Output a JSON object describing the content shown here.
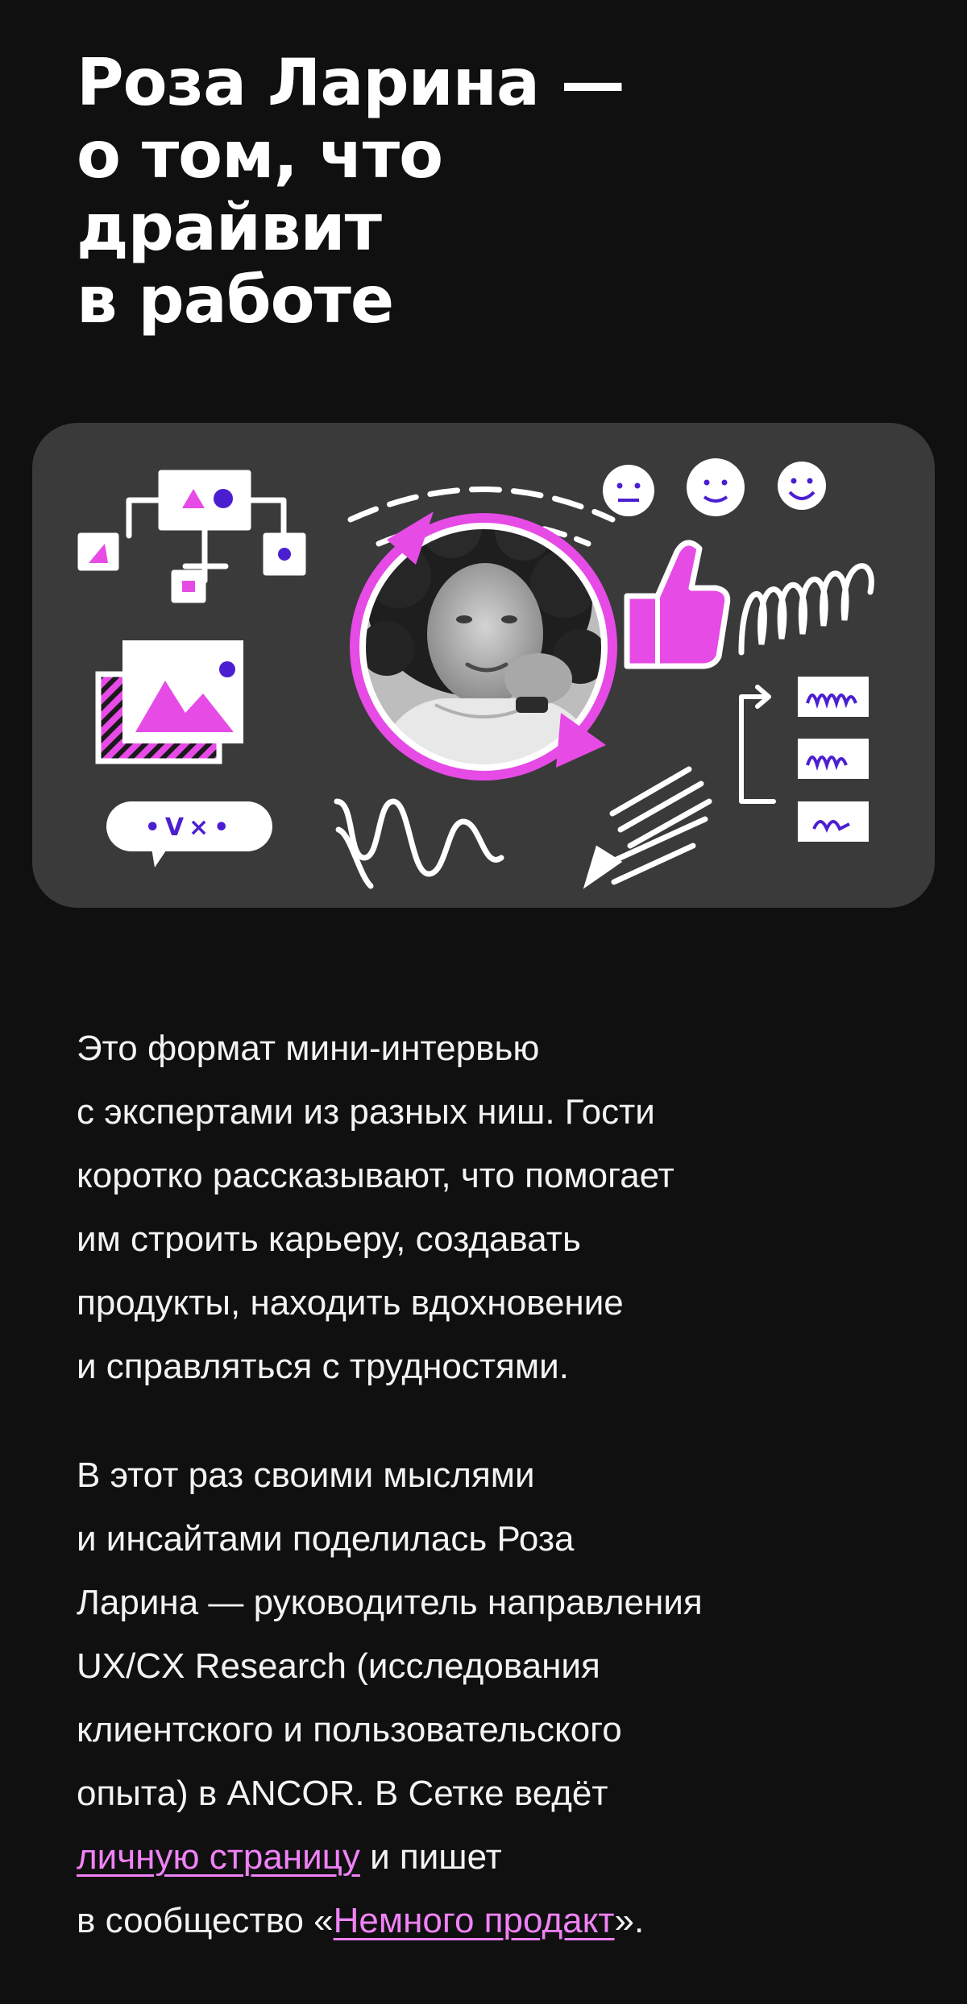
{
  "article": {
    "title_lines": [
      "Роза Ларина —",
      "о том, что",
      "драйвит",
      "в работе"
    ]
  },
  "hero": {
    "illustration_alt": "Роза Ларина",
    "accent_color": "#e64be6",
    "background_color": "#3a3a3a",
    "bubble_symbols": "•V×•"
  },
  "intro": {
    "lines": [
      "Это формат мини-интервью",
      "с экспертами из разных ниш. Гости",
      "коротко рассказывают, что помогает",
      "им строить карьеру, создавать",
      "продукты, находить вдохновение",
      "и справляться с трудностями."
    ]
  },
  "bio": {
    "lines": [
      "В этот раз своими мыслями",
      "и инсайтами поделилась Роза",
      "Ларина — руководитель направления",
      "UX/CX Research (исследования",
      "клиентского и пользовательского",
      "опыта) в ANCOR. В Сетке ведёт"
    ],
    "personal_page_link": "личную страницу",
    "after_link": " и пишет",
    "community_prefix": "в сообщество «",
    "community_link": "Немного продакт",
    "community_suffix": "»."
  },
  "colors": {
    "background": "#101010",
    "text": "#ffffff",
    "link": "#f082f6"
  }
}
